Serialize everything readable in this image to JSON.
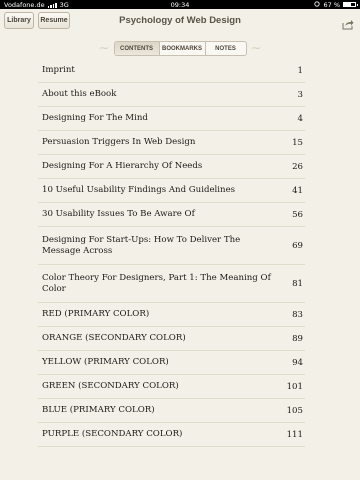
{
  "status_bar": {
    "carrier": "Vodafone.de",
    "network": "3G",
    "time": "09:34",
    "battery_text": "67 %",
    "battery_level": 0.67
  },
  "toolbar": {
    "library_label": "Library",
    "resume_label": "Resume",
    "book_title": "Psychology of Web Design"
  },
  "tabs": [
    {
      "label": "CONTENTS",
      "active": true
    },
    {
      "label": "BOOKMARKS",
      "active": false
    },
    {
      "label": "NOTES",
      "active": false
    }
  ],
  "toc": [
    {
      "title": "Imprint",
      "page": "1"
    },
    {
      "title": "About this eBook",
      "page": "3"
    },
    {
      "title": "Designing For The Mind",
      "page": "4"
    },
    {
      "title": "Persuasion Triggers In Web Design",
      "page": "15"
    },
    {
      "title": "Designing For A Hierarchy Of Needs",
      "page": "26"
    },
    {
      "title": "10 Useful Usability Findings And Guidelines",
      "page": "41"
    },
    {
      "title": "30 Usability Issues To Be Aware Of",
      "page": "56"
    },
    {
      "title": "Designing For Start-Ups: How To Deliver The Message Across",
      "page": "69"
    },
    {
      "title": "Color Theory For Designers, Part 1: The Meaning Of Color",
      "page": "81"
    },
    {
      "title": "RED (PRIMARY COLOR)",
      "page": "83"
    },
    {
      "title": "ORANGE (SECONDARY COLOR)",
      "page": "89"
    },
    {
      "title": "YELLOW (PRIMARY COLOR)",
      "page": "94"
    },
    {
      "title": "GREEN (SECONDARY COLOR)",
      "page": "101"
    },
    {
      "title": "BLUE (PRIMARY COLOR)",
      "page": "105"
    },
    {
      "title": "PURPLE (SECONDARY COLOR)",
      "page": "111"
    }
  ]
}
